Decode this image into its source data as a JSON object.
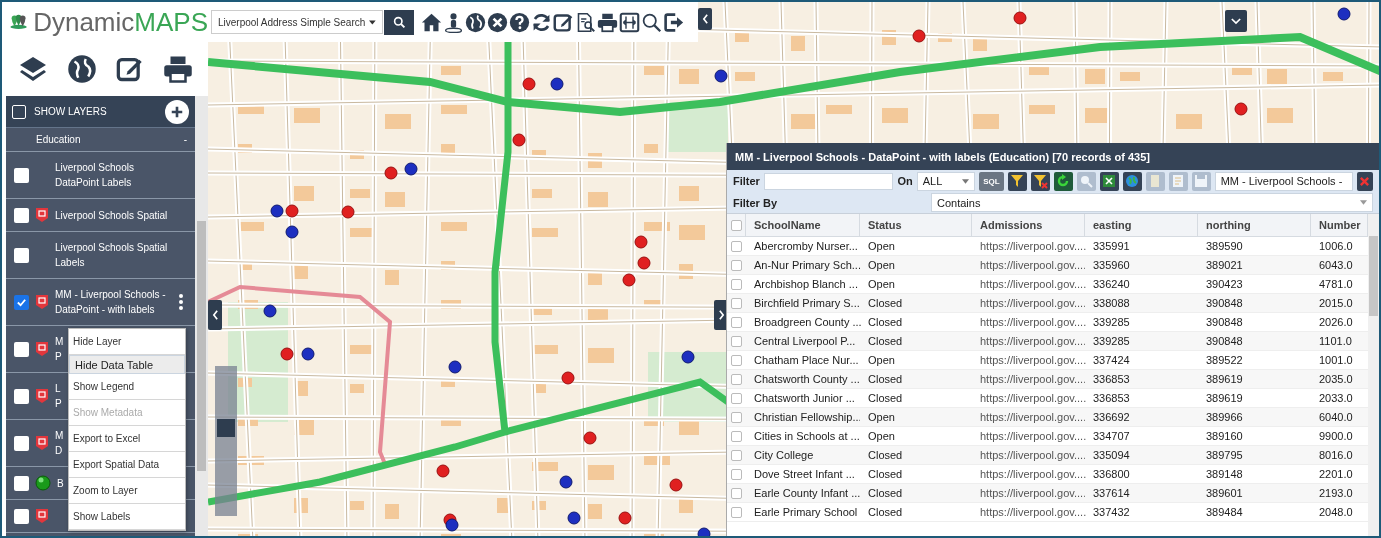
{
  "header": {
    "logo": {
      "part1": "Dynamic",
      "part2": "MAPS"
    },
    "search": {
      "value": "Liverpool Address Simple Search"
    }
  },
  "layers_panel": {
    "title": "SHOW LAYERS",
    "show_all_checked": false,
    "group": {
      "name": "Education",
      "toggle": "-"
    },
    "layers": [
      {
        "lines": [
          "Liverpool Schools",
          "DataPoint Labels"
        ],
        "checked": false,
        "kind": "plain",
        "menu_button": false
      },
      {
        "lines": [
          "Liverpool Schools Spatial"
        ],
        "checked": false,
        "kind": "shield",
        "menu_button": false
      },
      {
        "lines": [
          "Liverpool Schools Spatial",
          "Labels"
        ],
        "checked": false,
        "kind": "plain",
        "menu_button": false
      },
      {
        "lines": [
          "MM - Liverpool Schools -",
          "DataPoint - with labels"
        ],
        "checked": true,
        "kind": "shield",
        "menu_button": true
      },
      {
        "lines": [
          "M",
          "P"
        ],
        "checked": false,
        "kind": "shield",
        "menu_button": false
      },
      {
        "lines": [
          "L",
          "P"
        ],
        "checked": false,
        "kind": "shield",
        "menu_button": false
      },
      {
        "lines": [
          "M",
          "D"
        ],
        "checked": false,
        "kind": "shield",
        "menu_button": false
      },
      {
        "lines": [
          "B"
        ],
        "checked": false,
        "kind": "dot",
        "menu_button": false
      },
      {
        "checked": false,
        "kind": "shield",
        "menu_button": false
      }
    ]
  },
  "context_menu": {
    "items": [
      {
        "label": "Hide Layer",
        "selected": false,
        "disabled": false
      },
      {
        "label": "Hide Data Table",
        "selected": true,
        "disabled": false
      },
      {
        "label": "Show Legend",
        "selected": false,
        "disabled": false
      },
      {
        "label": "Show Metadata",
        "selected": false,
        "disabled": true
      },
      {
        "label": "Export to Excel",
        "selected": false,
        "disabled": false
      },
      {
        "label": "Export Spatial Data",
        "selected": false,
        "disabled": false
      },
      {
        "label": "Zoom to Layer",
        "selected": false,
        "disabled": false
      },
      {
        "label": "Show Labels",
        "selected": false,
        "disabled": false
      }
    ]
  },
  "zoom_slider": {
    "level": 0.6
  },
  "data_table": {
    "title": "MM - Liverpool Schools - DataPoint - with labels (Education) [70 records of 435]",
    "filter": {
      "label": "Filter",
      "on_label": "On",
      "on_value": "ALL",
      "sql": "SQL",
      "layer_select": "MM - Liverpool Schools -"
    },
    "filter_by": {
      "label": "Filter By",
      "value": "Contains"
    },
    "all_checked": false,
    "columns": [
      "SchoolName",
      "Status",
      "Admissions",
      "easting",
      "northing",
      "Number"
    ],
    "rows": [
      {
        "checked": false,
        "cells": [
          "Abercromby Nurser...",
          "Open",
          "https://liverpool.gov....",
          "335991",
          "389590",
          "1006.0"
        ]
      },
      {
        "checked": false,
        "cells": [
          "An-Nur Primary Sch...",
          "Open",
          "https://liverpool.gov....",
          "335960",
          "389021",
          "6043.0"
        ]
      },
      {
        "checked": false,
        "cells": [
          "Archbishop Blanch ...",
          "Open",
          "https://liverpool.gov....",
          "336240",
          "390423",
          "4781.0"
        ]
      },
      {
        "checked": false,
        "cells": [
          "Birchfield Primary S...",
          "Closed",
          "https://liverpool.gov....",
          "338088",
          "390848",
          "2015.0"
        ]
      },
      {
        "checked": false,
        "cells": [
          "Broadgreen County ...",
          "Closed",
          "https://liverpool.gov....",
          "339285",
          "390848",
          "2026.0"
        ]
      },
      {
        "checked": false,
        "cells": [
          "Central Liverpool P...",
          "Closed",
          "https://liverpool.gov....",
          "339285",
          "390848",
          "1101.0"
        ]
      },
      {
        "checked": false,
        "cells": [
          "Chatham Place Nur...",
          "Open",
          "https://liverpool.gov....",
          "337424",
          "389522",
          "1001.0"
        ]
      },
      {
        "checked": false,
        "cells": [
          "Chatsworth County ...",
          "Closed",
          "https://liverpool.gov....",
          "336853",
          "389619",
          "2035.0"
        ]
      },
      {
        "checked": false,
        "cells": [
          "Chatsworth Junior ...",
          "Closed",
          "https://liverpool.gov....",
          "336853",
          "389619",
          "2033.0"
        ]
      },
      {
        "checked": false,
        "cells": [
          "Christian Fellowship...",
          "Open",
          "https://liverpool.gov....",
          "336692",
          "389966",
          "6040.0"
        ]
      },
      {
        "checked": false,
        "cells": [
          "Cities in Schools at ...",
          "Open",
          "https://liverpool.gov....",
          "334707",
          "389160",
          "9900.0"
        ]
      },
      {
        "checked": false,
        "cells": [
          "City College",
          "Closed",
          "https://liverpool.gov....",
          "335094",
          "389795",
          "8016.0"
        ]
      },
      {
        "checked": false,
        "cells": [
          "Dove Street Infant ...",
          "Closed",
          "https://liverpool.gov....",
          "336800",
          "389148",
          "2201.0"
        ]
      },
      {
        "checked": false,
        "cells": [
          "Earle County Infant ...",
          "Closed",
          "https://liverpool.gov....",
          "337614",
          "389601",
          "2193.0"
        ]
      },
      {
        "checked": false,
        "cells": [
          "Earle Primary School",
          "Closed",
          "https://liverpool.gov....",
          "337432",
          "389484",
          "2048.0"
        ]
      }
    ]
  }
}
